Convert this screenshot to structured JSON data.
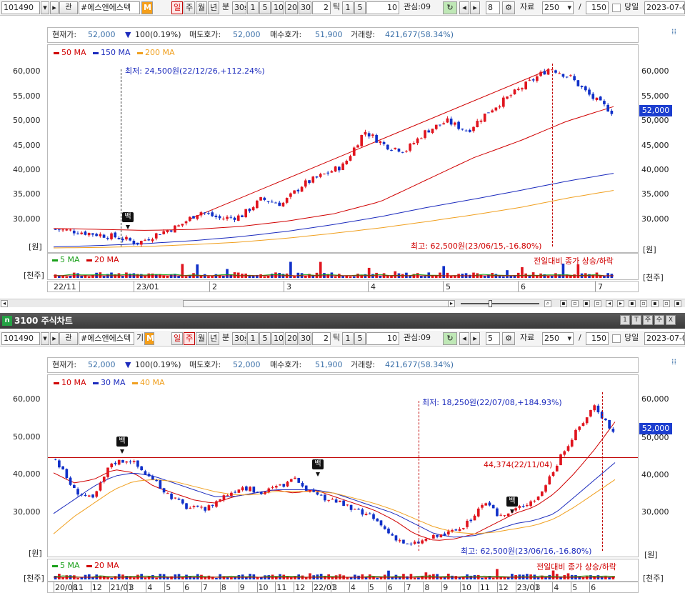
{
  "top": {
    "toolbar": {
      "code": "101490",
      "name": "#에스앤에스텍",
      "gwan": "관",
      "m_badge": "M",
      "period_buttons": [
        "일",
        "주",
        "월",
        "년",
        "분"
      ],
      "minute_buttons": [
        "30s",
        "1",
        "5",
        "10",
        "20",
        "30"
      ],
      "tick_value": "2",
      "tick_label": "틱",
      "tick_buttons": [
        "1",
        "5",
        "10"
      ],
      "interest_label": "관심:09",
      "page_value": "8",
      "data_label": "자료",
      "data_count": "250",
      "slash": "/",
      "data_total": "150",
      "today_label": "당일",
      "date": "2023-07-0"
    },
    "info": {
      "current_label": "현재가:",
      "current_value": "52,000",
      "change_arrow": "▼",
      "change_value": "100(0.19%)",
      "ask_label": "매도호가:",
      "ask_value": "52,000",
      "bid_label": "매수호가:",
      "bid_value": "51,900",
      "volume_label": "거래량:",
      "volume_value": "421,677(58.34%)"
    },
    "legend": [
      {
        "label": "50 MA",
        "color": "#d00000"
      },
      {
        "label": "150 MA",
        "color": "#1c2bbd"
      },
      {
        "label": "200 MA",
        "color": "#f0a020"
      }
    ],
    "y_ticks": [
      "60,000",
      "55,000",
      "50,000",
      "45,000",
      "40,000",
      "35,000",
      "30,000"
    ],
    "unit_price": "[원]",
    "price_badge": "52,000",
    "low_annot": "최저: 24,500원(22/12/26,+112.24%)",
    "high_annot": "최고: 62,500원(23/06/15,-16.80%)",
    "vol_legend": [
      {
        "label": "5 MA",
        "color": "#1aa01a"
      },
      {
        "label": "20 MA",
        "color": "#d00000"
      }
    ],
    "vol_note": "전일대비 종가 상승/하락",
    "unit_vol": "[천주]",
    "x_ticks": [
      "22/11",
      "23/01",
      "2",
      "3",
      "4",
      "5",
      "6",
      "7"
    ],
    "signal_label": "백"
  },
  "bottom": {
    "title": "3100 주식차트",
    "logo": "n",
    "window_buttons": [
      "1",
      "T",
      "주",
      "수",
      "X"
    ],
    "toolbar": {
      "code": "101490",
      "name": "#에스앤에스텍",
      "gwan": "기",
      "m_badge": "M",
      "period_buttons": [
        "일",
        "주",
        "월",
        "년",
        "분"
      ],
      "minute_buttons": [
        "30s",
        "1",
        "5",
        "10",
        "20",
        "30"
      ],
      "tick_value": "2",
      "tick_label": "틱",
      "tick_buttons": [
        "1",
        "5",
        "10"
      ],
      "interest_label": "관심:09",
      "page_value": "5",
      "data_label": "자료",
      "data_count": "250",
      "slash": "/",
      "data_total": "150",
      "today_label": "당일",
      "date": "2023-07-0"
    },
    "info": {
      "current_label": "현재가:",
      "current_value": "52,000",
      "change_arrow": "▼",
      "change_value": "100(0.19%)",
      "ask_label": "매도호가:",
      "ask_value": "52,000",
      "bid_label": "매수호가:",
      "bid_value": "51,900",
      "volume_label": "거래량:",
      "volume_value": "421,677(58.34%)"
    },
    "legend": [
      {
        "label": "10 MA",
        "color": "#d00000"
      },
      {
        "label": "30 MA",
        "color": "#1c2bbd"
      },
      {
        "label": "40 MA",
        "color": "#f0a020"
      }
    ],
    "y_ticks": [
      "60,000",
      "50,000",
      "40,000",
      "30,000"
    ],
    "unit_price": "[원]",
    "price_badge": "52,000",
    "low_annot": "최저: 18,250원(22/07/08,+184.93%)",
    "high_annot": "최고: 62,500원(23/06/16,-16.80%)",
    "hline_annot": "44,374(22/11/04)",
    "vol_legend": [
      {
        "label": "5 MA",
        "color": "#1aa01a"
      },
      {
        "label": "20 MA",
        "color": "#d00000"
      }
    ],
    "vol_note": "전일대비 종가 상승/하락",
    "unit_vol": "[천주]",
    "x_ticks": [
      "20/08",
      "11",
      "12",
      "21/01",
      "3",
      "4",
      "5",
      "6",
      "7",
      "8",
      "9",
      "10",
      "11",
      "12",
      "22/01",
      "3",
      "4",
      "5",
      "6",
      "7",
      "8",
      "9",
      "10",
      "11",
      "12",
      "23/01",
      "3",
      "4",
      "5",
      "6"
    ],
    "signal_label": "백"
  },
  "chart_data": [
    {
      "type": "candlestick",
      "title": "",
      "ylabel": "[원]",
      "ylim": [
        24000,
        63000
      ],
      "yticks": [
        60000,
        55000,
        50000,
        45000,
        40000,
        35000,
        30000
      ],
      "x_labels": [
        "22/11",
        "23/01",
        "2",
        "3",
        "4",
        "5",
        "6",
        "7"
      ],
      "series": [
        {
          "name": "50 MA",
          "values": [
            28000,
            27800,
            27600,
            27800,
            28400,
            29500,
            31000,
            33500,
            38000,
            42500,
            46000,
            50000,
            53000
          ]
        },
        {
          "name": "150 MA",
          "values": [
            24200,
            24500,
            24900,
            25500,
            26300,
            27400,
            28800,
            30400,
            32300,
            34000,
            35800,
            37700,
            39300
          ]
        },
        {
          "name": "200 MA",
          "values": [
            24000,
            24100,
            24300,
            24700,
            25200,
            26000,
            27000,
            28100,
            29400,
            30800,
            32300,
            34200,
            35800
          ]
        }
      ],
      "close_path": [
        27800,
        27400,
        26800,
        26200,
        25000,
        27000,
        28500,
        31500,
        30000,
        30500,
        34000,
        33000,
        37000,
        39000,
        41000,
        48000,
        45000,
        44000,
        48000,
        50000,
        48000,
        52000,
        55000,
        58000,
        61000,
        59000,
        55000,
        52000
      ],
      "current_price": 52000,
      "annotations": [
        "최저: 24,500원(22/12/26,+112.24%)",
        "최고: 62,500원(23/06/15,-16.80%)"
      ]
    },
    {
      "type": "candlestick",
      "title": "",
      "ylabel": "[원]",
      "ylim": [
        17000,
        65000
      ],
      "yticks": [
        60000,
        50000,
        40000,
        30000
      ],
      "x_labels": [
        "20/08",
        "11",
        "12",
        "21/01",
        "3",
        "4",
        "5",
        "6",
        "7",
        "8",
        "9",
        "10",
        "11",
        "12",
        "22/01",
        "3",
        "4",
        "5",
        "6",
        "7",
        "8",
        "9",
        "10",
        "11",
        "12",
        "23/01",
        "3",
        "4",
        "5",
        "6"
      ],
      "series": [
        {
          "name": "10 MA",
          "values": [
            40000,
            37000,
            38000,
            41000,
            40000,
            36000,
            34000,
            32000,
            31000,
            33000,
            34000,
            35000,
            34000,
            35000,
            33000,
            31000,
            29000,
            26000,
            22000,
            20000,
            20500,
            22000,
            25000,
            28000,
            30000,
            34000,
            40000,
            47000,
            55000
          ]
        },
        {
          "name": "30 MA",
          "values": [
            28000,
            32000,
            36000,
            39000,
            40000,
            39000,
            37000,
            35000,
            33000,
            33000,
            34000,
            35000,
            35000,
            35000,
            34000,
            32000,
            30000,
            28000,
            25000,
            22000,
            21000,
            21500,
            23000,
            25000,
            26000,
            28000,
            33000,
            38000,
            43000
          ]
        },
        {
          "name": "40 MA",
          "values": [
            22000,
            27000,
            31000,
            35000,
            37500,
            38000,
            37500,
            36000,
            34500,
            33500,
            33500,
            34500,
            34500,
            34500,
            34000,
            32500,
            31000,
            29000,
            26500,
            24000,
            22500,
            22000,
            22500,
            23500,
            24500,
            26500,
            30000,
            34000,
            38000
          ]
        }
      ],
      "close_path": [
        44000,
        35000,
        32000,
        43000,
        44000,
        39000,
        34000,
        30000,
        29000,
        33000,
        36000,
        34000,
        36000,
        38000,
        33000,
        32000,
        29000,
        27000,
        22000,
        18500,
        20500,
        22000,
        24000,
        31000,
        27000,
        30000,
        33000,
        43000,
        52000,
        60000,
        52000
      ],
      "current_price": 52000,
      "reference_line": 44374,
      "annotations": [
        "최저: 18,250원(22/07/08,+184.93%)",
        "최고: 62,500원(23/06/16,-16.80%)",
        "44,374(22/11/04)"
      ]
    }
  ]
}
